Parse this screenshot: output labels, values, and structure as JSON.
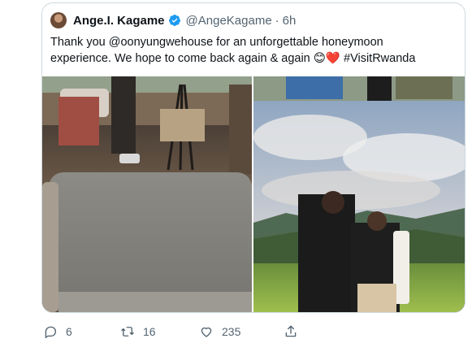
{
  "tweet": {
    "author_name": "Ange.I. Kagame",
    "handle": "@AngeKagame",
    "separator": "·",
    "time": "6h",
    "text_line1": "Thank you @oonyungwehouse for an unforgettable honeymoon",
    "text_line2": "experience. We hope to come back again & again",
    "emoji1": "😊",
    "emoji2": "❤️",
    "hashtag": "#VisitRwanda"
  },
  "actions": {
    "reply_count": "6",
    "retweet_count": "16",
    "like_count": "235"
  },
  "colors": {
    "verified": "#1d9bf0",
    "hashtag": "#0f1419",
    "muted": "#536471",
    "border": "#cfd9de"
  },
  "icons": [
    "verified-badge-icon",
    "reply-icon",
    "retweet-icon",
    "like-icon",
    "share-icon"
  ]
}
